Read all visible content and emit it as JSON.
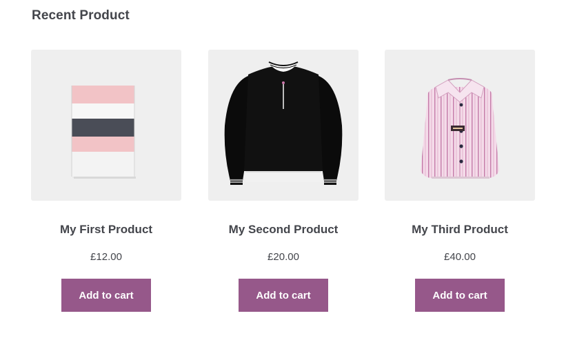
{
  "section": {
    "title": "Recent Product"
  },
  "products": [
    {
      "name": "My First Product",
      "price": "£12.00",
      "button": "Add to cart",
      "image": "striped-folded-towel"
    },
    {
      "name": "My Second Product",
      "price": "£20.00",
      "button": "Add to cart",
      "image": "black-sweatshirt"
    },
    {
      "name": "My Third Product",
      "price": "£40.00",
      "button": "Add to cart",
      "image": "pink-striped-shirt"
    }
  ],
  "colors": {
    "button": "#96588a",
    "button_text": "#ffffff",
    "thumb_bg": "#efefef",
    "text": "#43454b"
  }
}
